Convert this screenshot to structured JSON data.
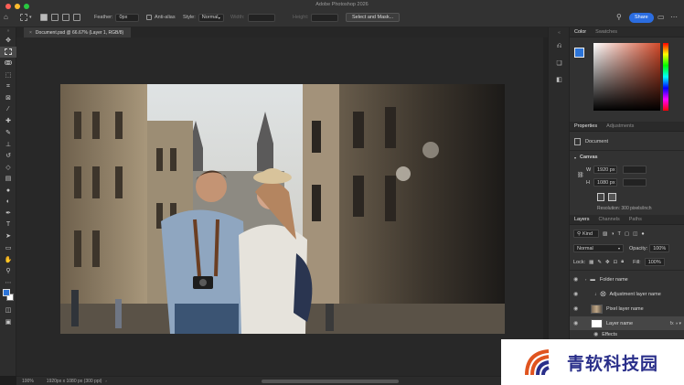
{
  "window": {
    "title": "Adobe Photoshop 2026",
    "traffic_colors": [
      "#ff5f57",
      "#febc2e",
      "#28c840"
    ]
  },
  "options_bar": {
    "feather_label": "Feather:",
    "feather_value": "0px",
    "antialias_label": "Anti-alias",
    "style_label": "Style:",
    "style_value": "Normal",
    "width_label": "Width:",
    "height_label": "Height:",
    "select_mask_label": "Select and Mask...",
    "share_label": "Share"
  },
  "document": {
    "tab_label": "Document.psd @ 66.67% (Layer 1, RGB/8)"
  },
  "status": {
    "zoom": "100%",
    "info": "1920px x 1080 px (300 ppi)"
  },
  "color_panel": {
    "tabs": [
      "Color",
      "Swatches"
    ],
    "foreground": "#2c74d8",
    "background": "#ffffff"
  },
  "properties_panel": {
    "tabs": [
      "Properties",
      "Adjustments"
    ],
    "doc_label": "Document",
    "canvas_label": "Canvas",
    "w_label": "W",
    "w_value": "1920 px",
    "h_label": "H",
    "h_value": "1080 px",
    "resolution": "Resolution: 300 pixels/inch"
  },
  "layers_panel": {
    "tabs": [
      "Layers",
      "Channels",
      "Paths"
    ],
    "filter_value": "Kind",
    "blend_mode": "Normal",
    "opacity_label": "Opacity:",
    "opacity_value": "100%",
    "lock_label": "Lock:",
    "fill_label": "Fill:",
    "fill_value": "100%",
    "layers": [
      {
        "name": "Folder name"
      },
      {
        "name": "Adjustment layer name"
      },
      {
        "name": "Pixel layer name"
      },
      {
        "name": "Layer name"
      }
    ],
    "effects_label": "Effects"
  },
  "watermark": {
    "text": "青软科技园"
  }
}
